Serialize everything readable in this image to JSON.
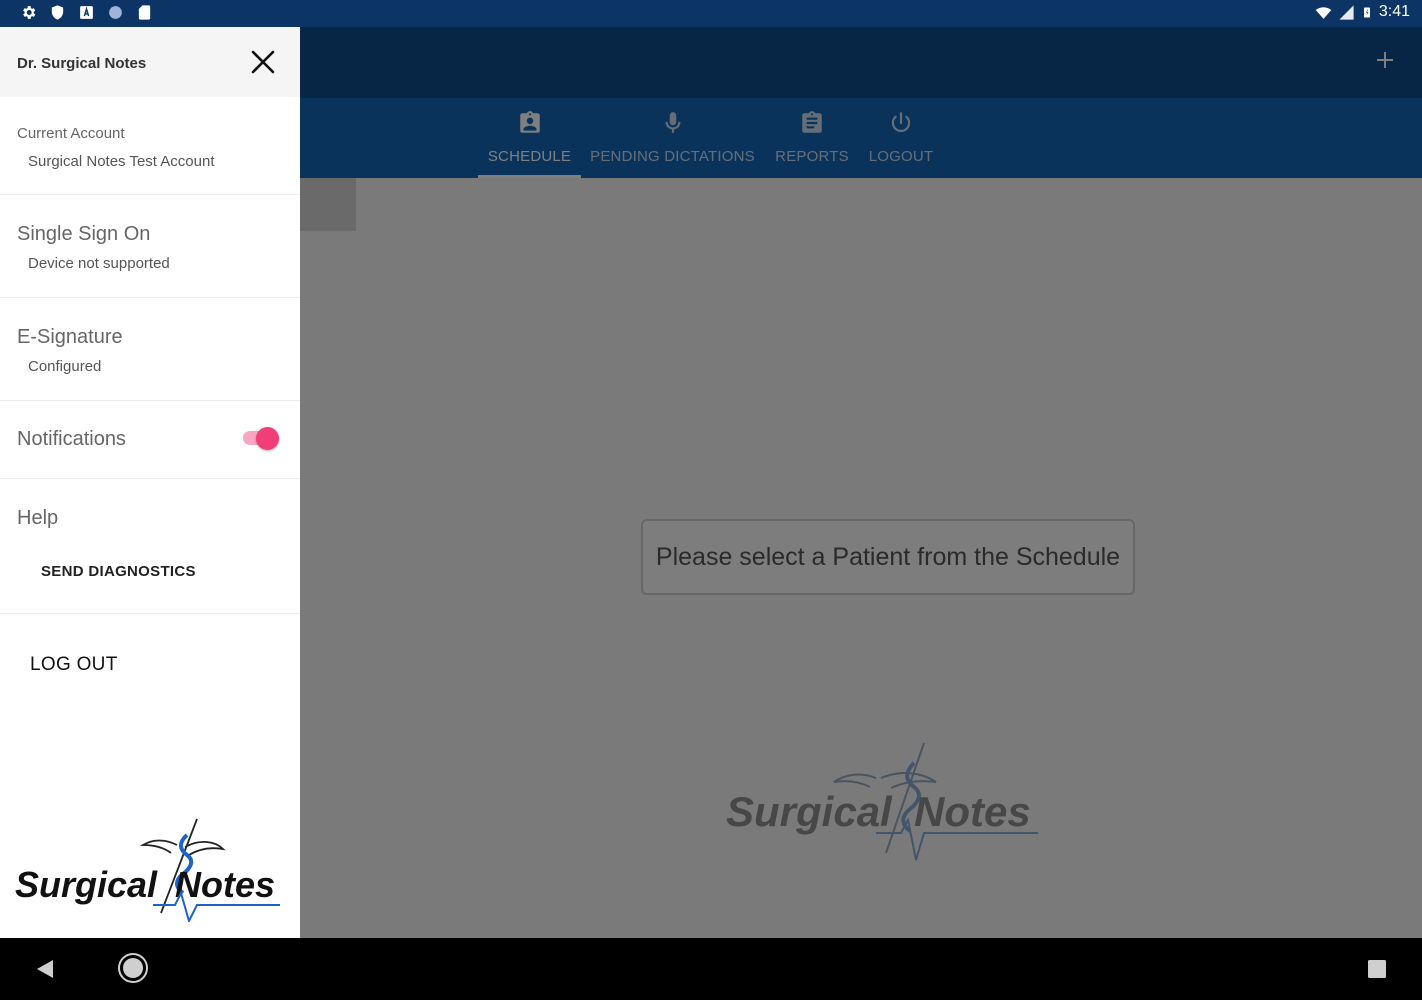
{
  "status_bar": {
    "left_icons": [
      "settings-icon",
      "shield-icon",
      "a-box-icon",
      "circle-icon",
      "sd-card-icon"
    ],
    "right_icons": [
      "wifi-icon",
      "cell-signal-icon",
      "battery-icon"
    ],
    "time": "3:41"
  },
  "toolbar": {
    "add_icon": "plus-icon"
  },
  "tabs": [
    {
      "label": "SCHEDULE",
      "icon": "assignment-ind-icon",
      "active": true
    },
    {
      "label": "PENDING DICTATIONS",
      "icon": "microphone-icon",
      "active": false
    },
    {
      "label": "REPORTS",
      "icon": "clipboard-icon",
      "active": false
    },
    {
      "label": "LOGOUT",
      "icon": "power-icon",
      "active": false
    }
  ],
  "content": {
    "prompt": "Please select a Patient from the Schedule",
    "logo_text_left": "Surgical",
    "logo_text_right": "Notes"
  },
  "drawer": {
    "title": "Dr. Surgical Notes",
    "close_icon": "close-icon",
    "current_account": {
      "label": "Current Account",
      "value": "Surgical Notes Test Account"
    },
    "single_sign_on": {
      "label": "Single Sign On",
      "value": "Device not supported"
    },
    "e_signature": {
      "label": "E-Signature",
      "value": "Configured"
    },
    "notifications": {
      "label": "Notifications",
      "enabled": true
    },
    "help": {
      "label": "Help",
      "send_diagnostics": "SEND DIAGNOSTICS"
    },
    "logout": "LOG OUT",
    "logo_text_left": "Surgical",
    "logo_text_right": "Notes"
  },
  "nav_bar": {
    "back_icon": "back-icon",
    "home_icon": "home-icon",
    "recents_icon": "recents-icon"
  },
  "colors": {
    "status_bar": "#0c3566",
    "toolbar": "#0f4a8a",
    "tab_bar": "#1466b8",
    "toggle_accent": "#f03e78"
  }
}
